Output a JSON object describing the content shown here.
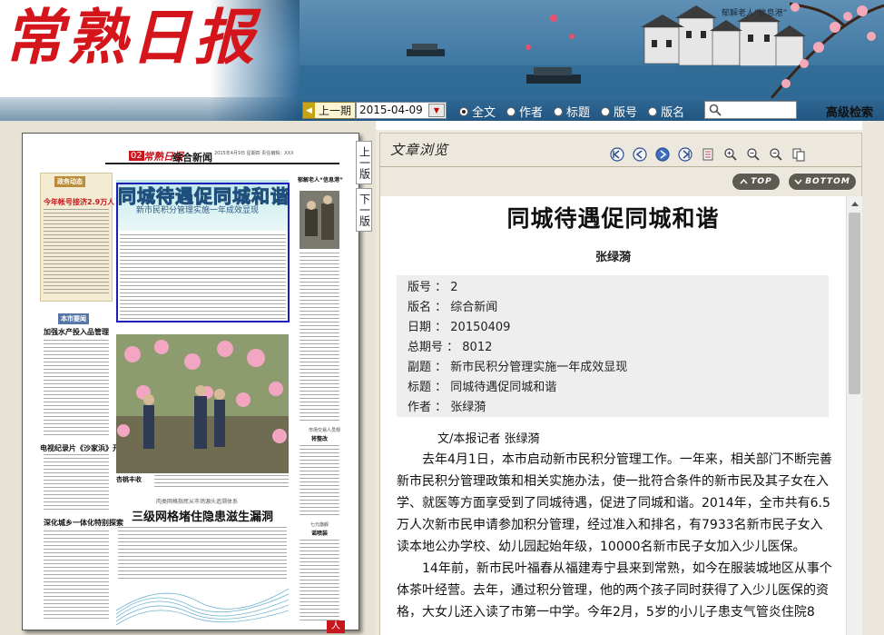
{
  "banner": {
    "logo_text": "常熟日报",
    "tagline": "郁解老人“信息港”"
  },
  "toolbar": {
    "prev_period_label": "上一期",
    "date_value": "2015-04-09",
    "search_options": [
      "全文",
      "作者",
      "标题",
      "版号",
      "版名"
    ],
    "selected_option": "全文",
    "search_placeholder": "",
    "advanced_search_label": "高级检索"
  },
  "left_panel": {
    "prev_page_label": "上一版",
    "next_page_label": "下一版",
    "corner_tag": "人"
  },
  "newspaper": {
    "page_number": "02",
    "paper_name": "常熟日报",
    "section_name": "综合新闻",
    "editors": "2015年4月9日  星期四\n责任编辑：XXX",
    "left_col_tag": "政务动态",
    "left_headlines": [
      "今年帐号接济2.9万人",
      "加强水产投入品管理",
      "电视纪录片《沙家浜》开拍",
      "深化城乡一体化特别探索"
    ],
    "left_col_tag2": "本市要闻",
    "lead_title": "同城待遇促同城和谐",
    "lead_subtitle": "新市民积分管理实施一年成效显现",
    "right_col_heading": "郁解老人“信息港”",
    "right_col_kicker": "市场交易人员规",
    "right_col_sub": "将整改",
    "right_col_sub2": "七元旗舰",
    "right_col_sub3": "谣喷装",
    "photo_caption": "杏桃丰收",
    "bottom_kicker": "肉类网格指挥从市场源头追溯体系",
    "bottom_headline": "三级网格堵住隐患滋生漏洞"
  },
  "viewer": {
    "title": "文章浏览",
    "tools": [
      "first-page-icon",
      "prev-icon",
      "next-icon",
      "last-page-icon",
      "notes-icon",
      "zoom-in-icon",
      "zoom-out-icon",
      "zoom-reset-icon",
      "copy-icon"
    ],
    "top_label": "TOP",
    "bottom_label": "BOTTOM"
  },
  "article": {
    "title": "同城待遇促同城和谐",
    "author": "张绿漪",
    "meta": [
      {
        "key": "版号",
        "value": "2"
      },
      {
        "key": "版名",
        "value": "综合新闻"
      },
      {
        "key": "日期",
        "value": "20150409"
      },
      {
        "key": "总期号",
        "value": "8012"
      },
      {
        "key": "副题",
        "value": "新市民积分管理实施一年成效显现"
      },
      {
        "key": "标题",
        "value": "同城待遇促同城和谐"
      },
      {
        "key": "作者",
        "value": "张绿漪"
      }
    ],
    "byline": "文/本报记者 张绿漪",
    "paragraphs": [
      "去年4月1日，本市启动新市民积分管理工作。一年来，相关部门不断完善新市民积分管理政策和相关实施办法，使一批符合条件的新市民及其子女在入学、就医等方面享受到了同城待遇，促进了同城和谐。2014年，全市共有6.5万人次新市民申请参加积分管理，经过准入和排名，有7933名新市民子女入读本地公办学校、幼儿园起始年级，10000名新市民子女加入少儿医保。",
      "14年前，新市民叶福春从福建寿宁县来到常熟，如今在服装城地区从事个体茶叶经营。去年，通过积分管理，他的两个孩子同时获得了入少儿医保的资格，大女儿还入读了市第一中学。今年2月，5岁的小儿子患支气管炎住院8"
    ]
  }
}
